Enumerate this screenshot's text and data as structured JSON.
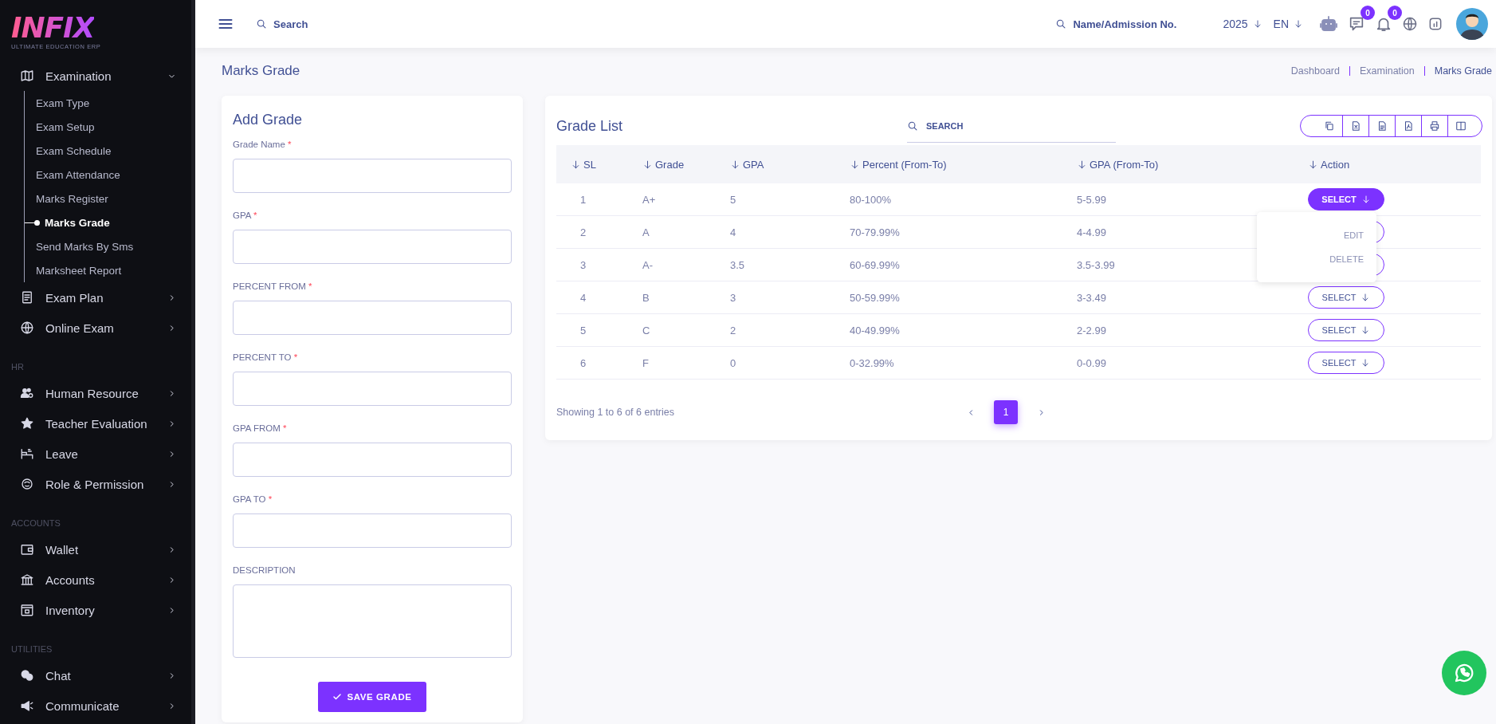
{
  "brand": {
    "logo": "INFIX",
    "tagline": "ULTIMATE EDUCATION ERP"
  },
  "sidebar": {
    "sections": [
      {
        "items": [
          {
            "label": "Examination",
            "expanded": true,
            "children": [
              {
                "label": "Exam Type",
                "selected": false
              },
              {
                "label": "Exam Setup",
                "selected": false
              },
              {
                "label": "Exam Schedule",
                "selected": false
              },
              {
                "label": "Exam Attendance",
                "selected": false
              },
              {
                "label": "Marks Register",
                "selected": false
              },
              {
                "label": "Marks Grade",
                "selected": true
              },
              {
                "label": "Send Marks By Sms",
                "selected": false
              },
              {
                "label": "Marksheet Report",
                "selected": false
              }
            ]
          },
          {
            "label": "Exam Plan",
            "expanded": false
          },
          {
            "label": "Online Exam",
            "expanded": false
          }
        ]
      },
      {
        "heading": "HR",
        "items": [
          {
            "label": "Human Resource",
            "expanded": false
          },
          {
            "label": "Teacher Evaluation",
            "expanded": false
          },
          {
            "label": "Leave",
            "expanded": false
          },
          {
            "label": "Role & Permission",
            "expanded": false
          }
        ]
      },
      {
        "heading": "ACCOUNTS",
        "items": [
          {
            "label": "Wallet",
            "expanded": false
          },
          {
            "label": "Accounts",
            "expanded": false
          },
          {
            "label": "Inventory",
            "expanded": false
          }
        ]
      },
      {
        "heading": "UTILITIES",
        "items": [
          {
            "label": "Chat",
            "expanded": false
          },
          {
            "label": "Communicate",
            "expanded": false
          }
        ]
      }
    ]
  },
  "header": {
    "search": {
      "placeholder": "Search"
    },
    "student_search": {
      "placeholder": "Name/Admission No."
    },
    "year": "2025",
    "language": "EN",
    "messages_badge": "0",
    "notifications_badge": "0"
  },
  "page": {
    "title": "Marks Grade",
    "breadcrumb": [
      "Dashboard",
      "Examination",
      "Marks Grade"
    ]
  },
  "form": {
    "title": "Add Grade",
    "fields": [
      {
        "label": "Grade Name",
        "required": true,
        "kind": "input"
      },
      {
        "label": "GPA",
        "required": true,
        "kind": "input"
      },
      {
        "label": "PERCENT FROM",
        "required": true,
        "kind": "input"
      },
      {
        "label": "PERCENT TO",
        "required": true,
        "kind": "input"
      },
      {
        "label": "GPA FROM",
        "required": true,
        "kind": "input"
      },
      {
        "label": "GPA TO",
        "required": true,
        "kind": "input"
      },
      {
        "label": "DESCRIPTION",
        "required": false,
        "kind": "textarea"
      }
    ],
    "required_mark": "*",
    "submit": "SAVE GRADE"
  },
  "grade_list": {
    "title": "Grade List",
    "search": {
      "placeholder": "SEARCH"
    },
    "columns": [
      "SL",
      "Grade",
      "GPA",
      "Percent (From-To)",
      "GPA (From-To)",
      "Action"
    ],
    "rows": [
      {
        "cells": [
          "1",
          "A+",
          "5",
          "80-100%",
          "5-5.99"
        ],
        "action": "SELECT",
        "selected": true
      },
      {
        "cells": [
          "2",
          "A",
          "4",
          "70-79.99%",
          "4-4.99"
        ]
      },
      {
        "cells": [
          "3",
          "A-",
          "3.5",
          "60-69.99%",
          "3.5-3.99"
        ]
      },
      {
        "cells": [
          "4",
          "B",
          "3",
          "50-59.99%",
          "3-3.49"
        ],
        "action": "SELECT",
        "selected": false
      },
      {
        "cells": [
          "5",
          "C",
          "2",
          "40-49.99%",
          "2-2.99"
        ],
        "action": "SELECT",
        "selected": false
      },
      {
        "cells": [
          "6",
          "F",
          "0",
          "0-32.99%",
          "0-0.99"
        ],
        "action": "SELECT",
        "selected": false
      }
    ],
    "menu": [
      "EDIT",
      "DELETE"
    ],
    "footer": "Showing 1 to 6 of 6 entries",
    "pages": [
      {
        "label": "1",
        "selected": true
      }
    ]
  }
}
